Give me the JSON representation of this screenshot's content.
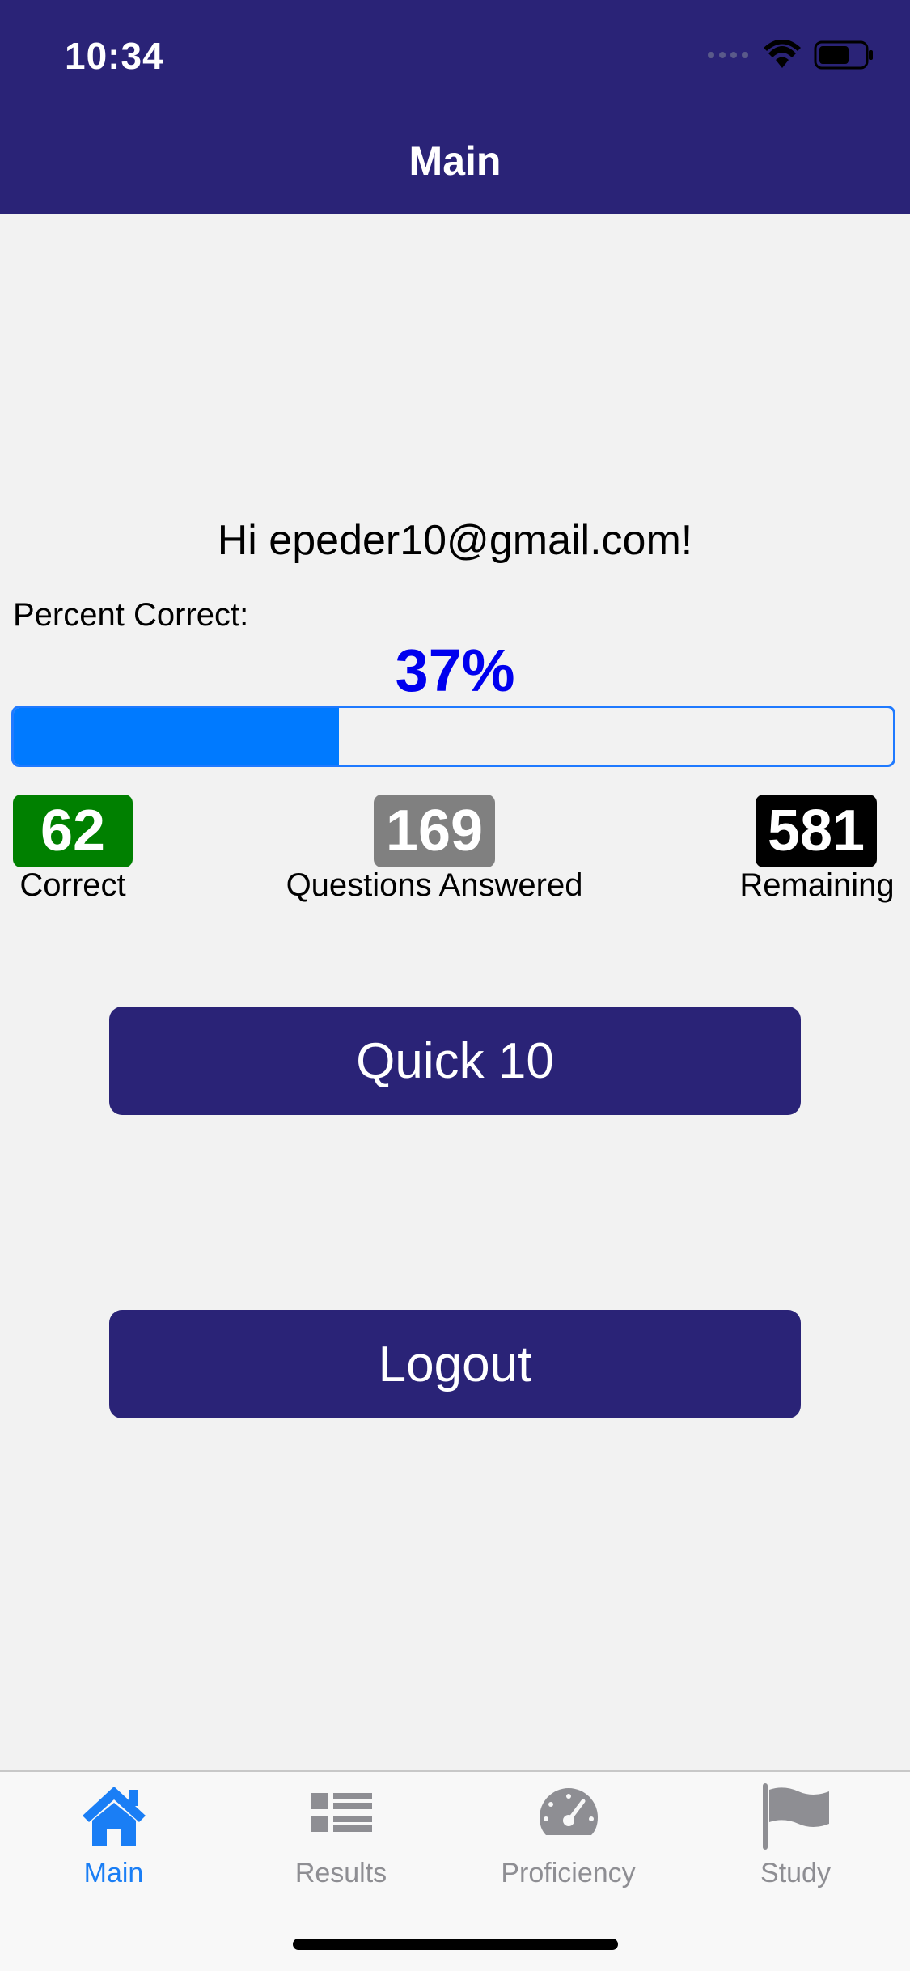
{
  "status_bar": {
    "time": "10:34"
  },
  "nav": {
    "title": "Main"
  },
  "greeting": "Hi epeder10@gmail.com!",
  "percent_correct": {
    "label": "Percent Correct:",
    "value_text": "37%",
    "value": 37
  },
  "stats": [
    {
      "value": "62",
      "label": "Correct",
      "color": "#008000"
    },
    {
      "value": "169",
      "label": "Questions Answered",
      "color": "#808080"
    },
    {
      "value": "581",
      "label": "Remaining",
      "color": "#000000"
    }
  ],
  "buttons": {
    "quick10": "Quick 10",
    "logout": "Logout"
  },
  "tabs": [
    {
      "label": "Main",
      "icon": "home-icon",
      "active": true
    },
    {
      "label": "Results",
      "icon": "list-icon",
      "active": false
    },
    {
      "label": "Proficiency",
      "icon": "speedometer-icon",
      "active": false
    },
    {
      "label": "Study",
      "icon": "flag-icon",
      "active": false
    }
  ],
  "colors": {
    "brand": "#2a2377",
    "accent": "#007aff",
    "percent_text": "#0000ee",
    "tab_active": "#1a7ef5",
    "tab_inactive": "#8e8e93"
  }
}
